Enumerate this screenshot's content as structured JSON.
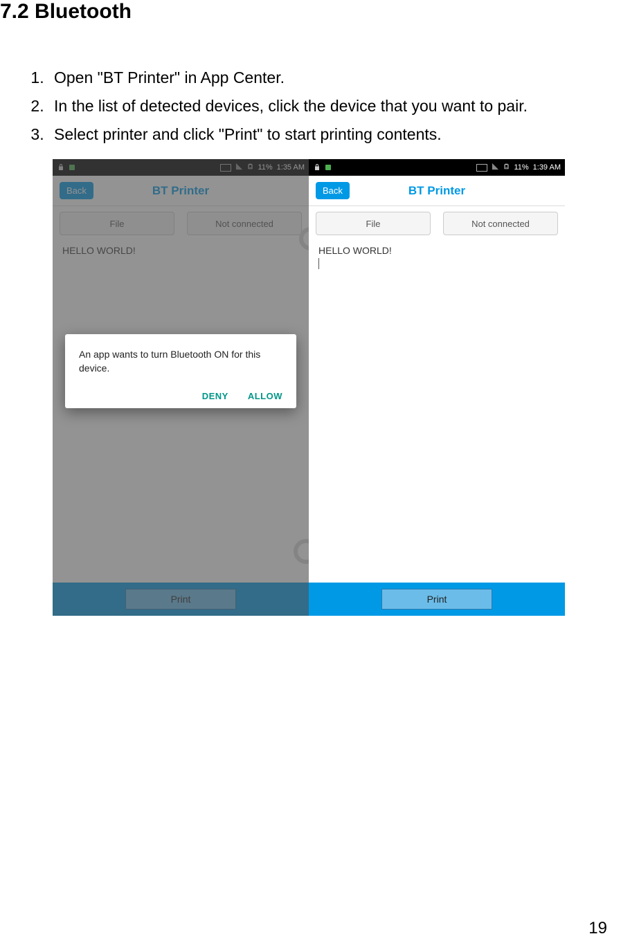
{
  "heading": "7.2 Bluetooth",
  "instructions": {
    "item1": "Open \"BT Printer\" in App Center.",
    "item2": "In the list of detected devices, click the device that you want to pair.",
    "item3": "Select printer and click \"Print\" to start printing contents."
  },
  "screen1": {
    "status_time": "1:35 AM",
    "status_battery": "11%",
    "back_label": "Back",
    "title": "BT Printer",
    "file_label": "File",
    "connect_label": "Not connected",
    "content_text": "HELLO WORLD!",
    "print_label": "Print",
    "dialog_text": "An app wants to turn Bluetooth ON for this device.",
    "deny_label": "DENY",
    "allow_label": "ALLOW"
  },
  "screen2": {
    "status_time": "1:39 AM",
    "status_battery": "11%",
    "back_label": "Back",
    "title": "BT Printer",
    "file_label": "File",
    "connect_label": "Not connected",
    "content_text": "HELLO WORLD!",
    "print_label": "Print"
  },
  "page_number": "19"
}
